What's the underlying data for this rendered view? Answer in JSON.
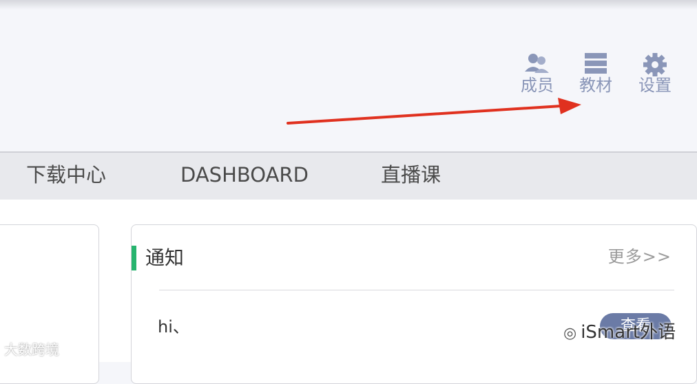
{
  "toolbar": {
    "members": {
      "label": "成员",
      "icon": "members-icon"
    },
    "materials": {
      "label": "教材",
      "icon": "materials-icon"
    },
    "settings": {
      "label": "设置",
      "icon": "gear-icon"
    }
  },
  "nav": {
    "items": [
      {
        "label": "下载中心"
      },
      {
        "label": "DASHBOARD"
      },
      {
        "label": "直播课"
      }
    ]
  },
  "notice_panel": {
    "title": "通知",
    "more_label": "更多>>",
    "items": [
      {
        "text": "hi、",
        "action_label": "查看"
      }
    ]
  },
  "watermarks": {
    "left": "大数跨境",
    "right": "iSmart外语"
  },
  "colors": {
    "icon_gray_blue": "#8a96b8",
    "accent_green": "#27b46e",
    "annotation_arrow": "#e0311f",
    "button_blue": "#6b7ba6"
  }
}
